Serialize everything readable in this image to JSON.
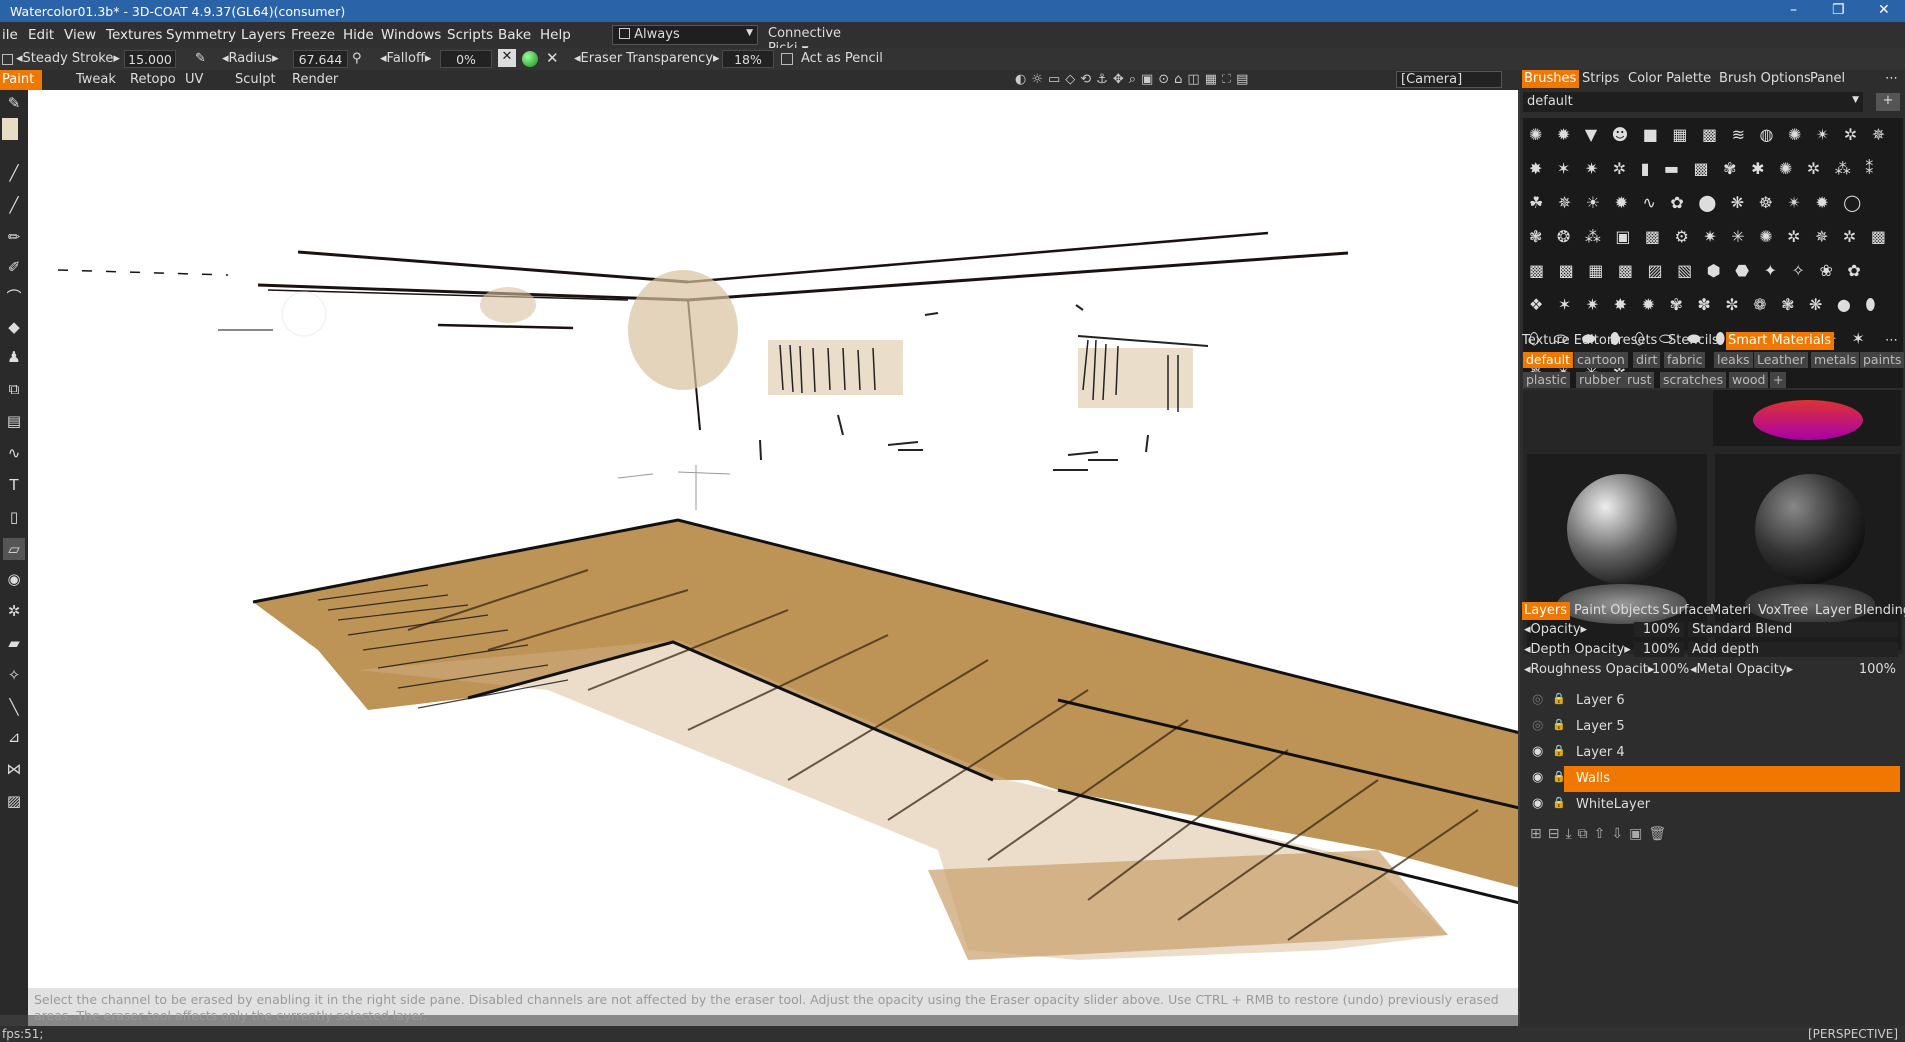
{
  "window": {
    "title": "Watercolor01.3b* - 3D-COAT 4.9.37(GL64)(consumer)",
    "minimize": "–",
    "restore": "❐",
    "close": "✕"
  },
  "menu": {
    "items": [
      "ile",
      "Edit",
      "View",
      "Textures",
      "Symmetry",
      "Layers",
      "Freeze",
      "Hide",
      "Windows",
      "Scripts",
      "Bake",
      "Help"
    ],
    "always": "Always",
    "connective": "Connective  Picki"
  },
  "toolbar": {
    "steady_stroke": "Steady  Stroke",
    "stroke_val": "15.000",
    "radius": "Radius",
    "radius_val": "67.644",
    "falloff": "Falloff",
    "falloff_val": "0%",
    "eraser_transparency": "Eraser  Transparency",
    "transparency_val": "18%",
    "act_as_pencil": "Act  as  Pencil"
  },
  "modes": {
    "items": [
      "Paint",
      "Tweak",
      "Retopo",
      "UV",
      "Sculpt",
      "Render"
    ],
    "active": "Paint",
    "camera": "[Camera]"
  },
  "hint": {
    "text": "Select the channel to be erased by enabling it in the right side pane. Disabled channels are not affected by the eraser tool. Adjust the opacity using the Eraser opacity slider above. Use CTRL + RMB to restore (undo) previously erased areas. The eraser tool affects only the currently selected layer."
  },
  "status": {
    "fps": "fps:51;",
    "view": "[PERSPECTIVE]"
  },
  "brushes_panel": {
    "tabs": [
      "Brushes",
      "Strips",
      "Color Palette",
      "Brush Options",
      "Panel"
    ],
    "preset": "default"
  },
  "materials_panel": {
    "tabs": [
      "Texture Editor",
      "Presets",
      "Stencils",
      "Smart Materials"
    ],
    "tags_row1": [
      "default",
      "cartoon",
      "dirt",
      "fabric",
      "leaks",
      "Leather",
      "metals",
      "paints"
    ],
    "tags_row2": [
      "plastic",
      "rubber",
      "rust",
      "scratches",
      "wood",
      "+"
    ]
  },
  "layers_panel": {
    "tabs": [
      "Layers",
      "Paint Objects",
      "Surface",
      "Materi",
      "VoxTree",
      "Layer",
      "Blending"
    ],
    "opacity_label": "Opacity",
    "opacity_val": "100%",
    "blend_mode": "Standard  Blend",
    "depth_label": "Depth  Opacity",
    "depth_val": "100%",
    "depth_mode": "Add  depth",
    "rough_label": "Roughness  Opacit",
    "rough_val": "100%",
    "metal_label": "Metal  Opacity",
    "metal_val": "100%",
    "layers": [
      {
        "name": "Layer  6",
        "visible": false
      },
      {
        "name": "Layer  5",
        "visible": false
      },
      {
        "name": "Layer  4",
        "visible": true
      },
      {
        "name": "Walls",
        "visible": true,
        "selected": true
      },
      {
        "name": "WhiteLayer",
        "visible": true
      }
    ]
  },
  "colors": {
    "accent": "#f07800",
    "title_blue": "#2b63a8",
    "wood": "#b98a48",
    "wash": "#d9c2a0"
  }
}
